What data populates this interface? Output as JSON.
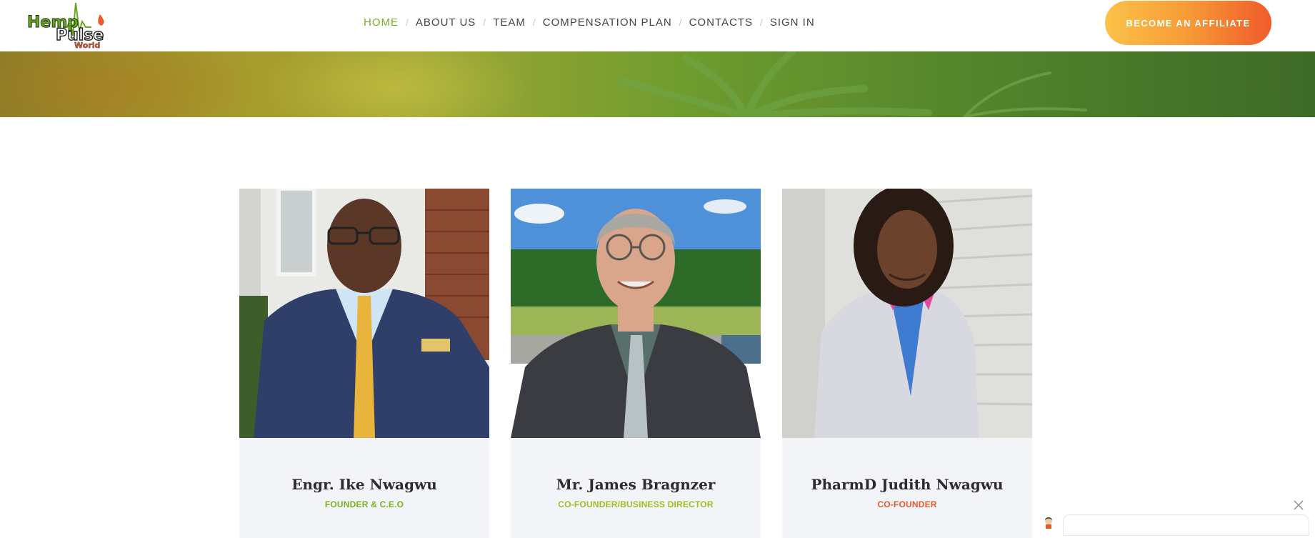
{
  "brand": {
    "logo_line1": "Hemp",
    "logo_line2": "Pulse",
    "logo_line3": "World"
  },
  "nav": {
    "items": [
      {
        "label": "HOME",
        "active": true
      },
      {
        "label": "ABOUT US",
        "active": false
      },
      {
        "label": "TEAM",
        "active": false
      },
      {
        "label": "COMPENSATION PLAN",
        "active": false
      },
      {
        "label": "CONTACTS",
        "active": false
      },
      {
        "label": "SIGN IN",
        "active": false
      }
    ],
    "separator": "/"
  },
  "cta": {
    "label": "BECOME AN AFFILIATE"
  },
  "team": [
    {
      "name": "Engr. Ike Nwagwu",
      "role": "FOUNDER & C.E.O",
      "role_color": "#7ab024"
    },
    {
      "name": "Mr. James Bragnzer",
      "role": "CO-FOUNDER/BUSINESS DIRECTOR",
      "role_color": "#9cbd22"
    },
    {
      "name": "PharmD Judith Nwagwu",
      "role": "CO-FOUNDER",
      "role_color": "#ea5a2a"
    }
  ],
  "colors": {
    "accent_green": "#7ab024",
    "accent_orange": "#f15a2b",
    "cta_start": "#fbc24a"
  },
  "icons": {
    "close": "close-icon",
    "chat": "chat-avatar-icon"
  }
}
